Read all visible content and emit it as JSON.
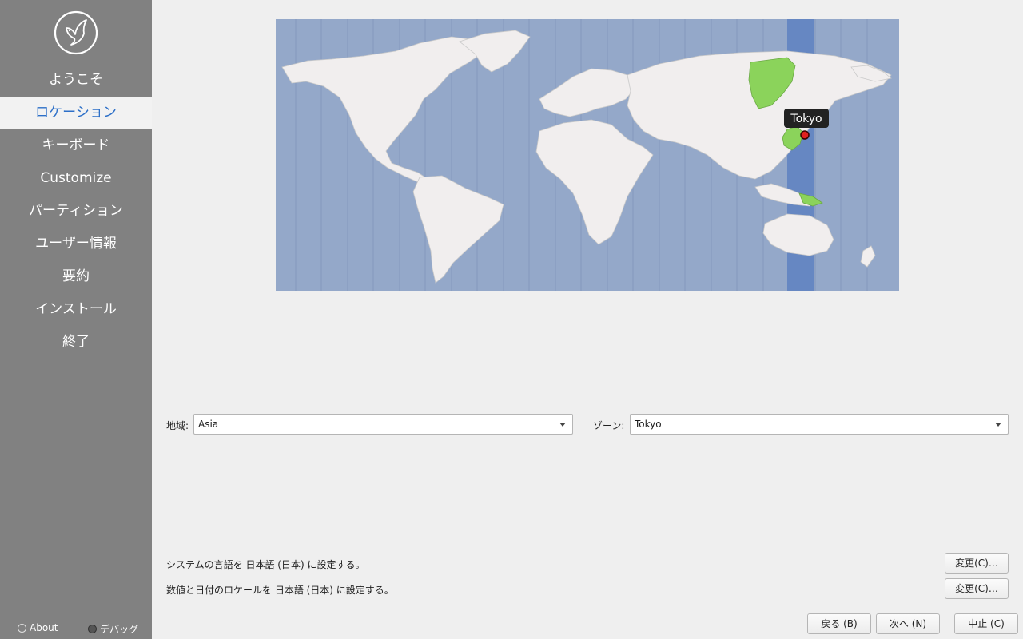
{
  "sidebar": {
    "logo_icon": "dove-icon",
    "items": [
      {
        "label": "ようこそ"
      },
      {
        "label": "ロケーション"
      },
      {
        "label": "キーボード"
      },
      {
        "label": "Customize"
      },
      {
        "label": "パーティション"
      },
      {
        "label": "ユーザー情報"
      },
      {
        "label": "要約"
      },
      {
        "label": "インストール"
      },
      {
        "label": "終了"
      }
    ],
    "active_index": 1,
    "about_label": "About",
    "debug_label": "デバッグ"
  },
  "map": {
    "selected_city": "Tokyo",
    "ocean_color": "#94a8c9",
    "highlight_color": "#8bd35b",
    "band_color": "#6687c2"
  },
  "location": {
    "region_label": "地域:",
    "region_value": "Asia",
    "zone_label": "ゾーン:",
    "zone_value": "Tokyo"
  },
  "locale": {
    "language_text": "システムの言語を 日本語 (日本) に設定する。",
    "format_text": "数値と日付のロケールを 日本語 (日本) に設定する。",
    "change_language_button": "変更(C)…",
    "change_format_button": "変更(C)…"
  },
  "footer": {
    "back_button": "戻る (B)",
    "next_button": "次へ (N)",
    "cancel_button": "中止 (C)"
  }
}
